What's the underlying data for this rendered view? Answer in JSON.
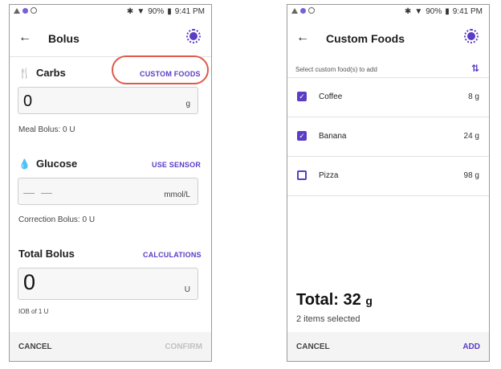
{
  "status_bar": {
    "battery": "90%",
    "time": "9:41 PM",
    "icons": [
      "bluetooth-icon",
      "wifi-icon"
    ]
  },
  "bolus_screen": {
    "title": "Bolus",
    "carbs": {
      "label": "Carbs",
      "link": "CUSTOM FOODS",
      "value": "0",
      "unit": "g",
      "helper": "Meal Bolus: 0 U"
    },
    "glucose": {
      "label": "Glucose",
      "link": "USE SENSOR",
      "value": "— —",
      "unit": "mmol/L",
      "helper": "Correction Bolus: 0 U"
    },
    "total": {
      "label": "Total Bolus",
      "link": "CALCULATIONS",
      "value": "0",
      "unit": "U",
      "helper": "IOB of 1 U"
    },
    "buttons": {
      "cancel": "CANCEL",
      "confirm": "CONFIRM"
    }
  },
  "custom_foods_screen": {
    "title": "Custom Foods",
    "subheader": "Select custom food(s) to add",
    "foods": [
      {
        "name": "Coffee",
        "weight": "8 g",
        "checked": true
      },
      {
        "name": "Banana",
        "weight": "24 g",
        "checked": true
      },
      {
        "name": "Pizza",
        "weight": "98 g",
        "checked": false
      }
    ],
    "total_label": "Total:",
    "total_value": "32",
    "total_unit": "g",
    "items_selected": "2 items selected",
    "buttons": {
      "cancel": "CANCEL",
      "add": "ADD"
    }
  },
  "colors": {
    "accent": "#5b3cc4",
    "highlight": "#e0584a"
  }
}
